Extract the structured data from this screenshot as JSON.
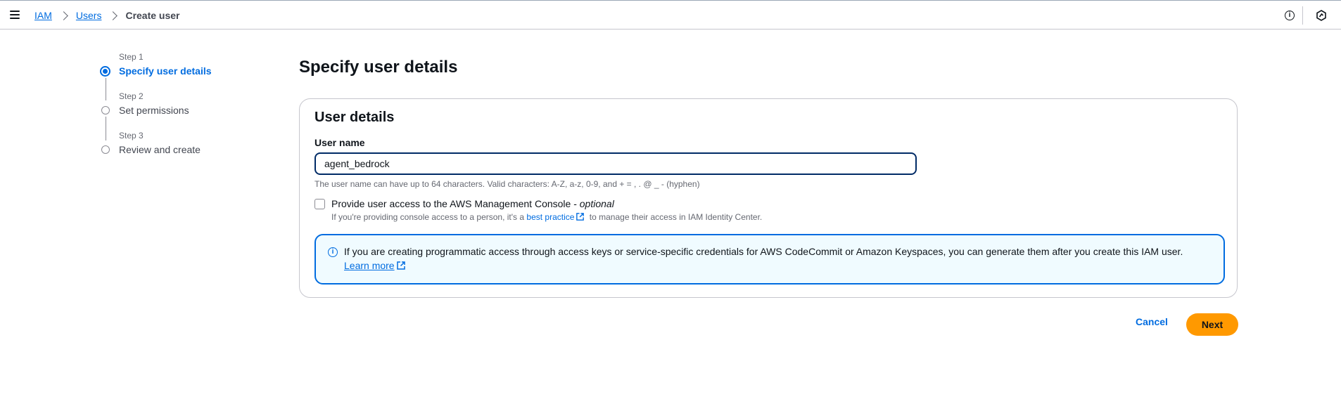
{
  "breadcrumb": {
    "items": [
      {
        "label": "IAM"
      },
      {
        "label": "Users"
      },
      {
        "label": "Create user"
      }
    ]
  },
  "steps": [
    {
      "step": "Step 1",
      "title": "Specify user details",
      "state": "active"
    },
    {
      "step": "Step 2",
      "title": "Set permissions",
      "state": "pending"
    },
    {
      "step": "Step 3",
      "title": "Review and create",
      "state": "pending"
    }
  ],
  "page": {
    "title": "Specify user details"
  },
  "user_details": {
    "title": "User details",
    "user_name_label": "User name",
    "user_name_value": "agent_bedrock",
    "constraint": "The user name can have up to 64 characters. Valid characters: A-Z, a-z, 0-9, and + = , . @ _ - (hyphen)",
    "console_access": {
      "label": "Provide user access to the AWS Management Console - ",
      "optional": "optional",
      "checked": false,
      "desc_prefix": "If you're providing console access to a person, it's a ",
      "desc_link": "best practice",
      "desc_suffix": " to manage their access in IAM Identity Center."
    },
    "alert": {
      "text": "If you are creating programmatic access through access keys or service-specific credentials for AWS CodeCommit or Amazon Keyspaces, you can generate them after you create this IAM user.",
      "link": "Learn more"
    }
  },
  "actions": {
    "cancel": "Cancel",
    "next": "Next"
  },
  "colors": {
    "accent": "#006ce0",
    "primary_button": "#ff9900",
    "alert_bg": "#f0fbff"
  },
  "icons": {
    "menu": "hamburger-menu-icon",
    "info": "info-icon",
    "tools": "tools-icon",
    "external": "external-link-icon"
  }
}
